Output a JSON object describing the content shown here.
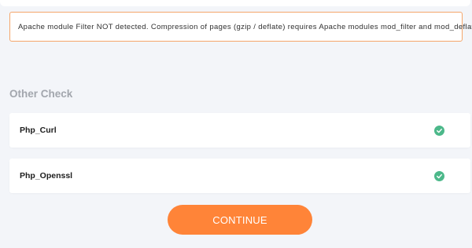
{
  "warning": {
    "message": "Apache module Filter NOT detected. Compression of pages (gzip / deflate) requires Apache modules mod_filter and mod_deflate",
    "border_color": "#f5a66b"
  },
  "other_check": {
    "title": "Other Check",
    "items": [
      {
        "label": "Php_Curl",
        "status_icon": "check-circle-icon",
        "status": "ok"
      },
      {
        "label": "Php_Openssl",
        "status_icon": "check-circle-icon",
        "status": "ok"
      }
    ],
    "success_color": "#4cb88a"
  },
  "actions": {
    "continue_label": "CONTINUE",
    "button_color": "#ff8438"
  },
  "colors": {
    "background": "#f3f5f9",
    "card": "#ffffff"
  }
}
